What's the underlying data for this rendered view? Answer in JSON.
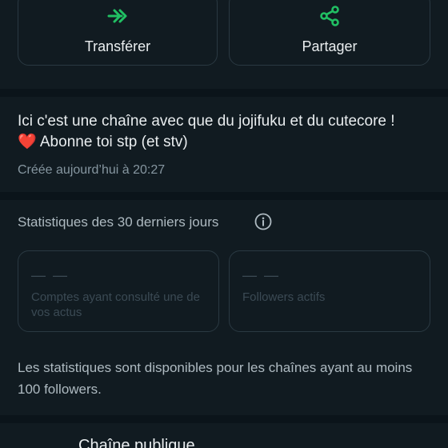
{
  "actions": {
    "forward_label": "Transférer",
    "share_label": "Partager",
    "accent_color": "#21c063"
  },
  "channel": {
    "description": "Ici c'est une chaîne avec que du jojifuku et du cutecore ! ❤️ Abonne toi stp (et stv)",
    "created": "Créée aujourd’hui à 20:27"
  },
  "stats": {
    "title": "Statistiques des 30 derniers jours",
    "cards": [
      {
        "value": "— —",
        "label": "Comptes ayant consulté une de vos actus"
      },
      {
        "value": "— —",
        "label": "Followers actifs"
      }
    ],
    "note": "Les statistiques sont disponibles pour les chaînes ayant au moins 100 followers."
  },
  "privacy": {
    "label": "Chaîne publique"
  }
}
